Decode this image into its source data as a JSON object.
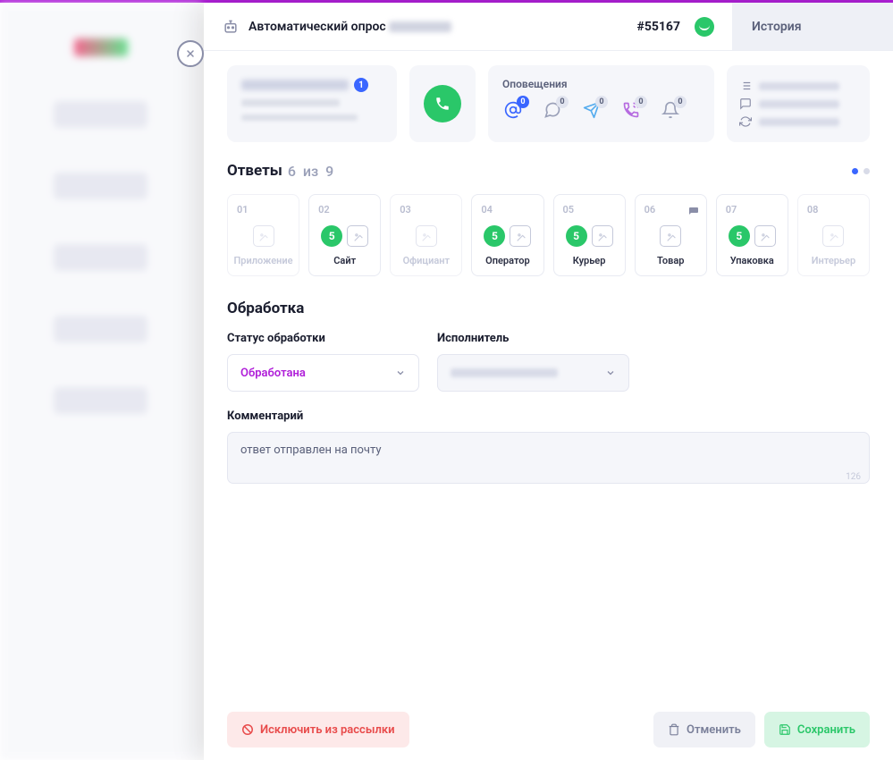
{
  "header": {
    "title_prefix": "Автоматический опрос",
    "ticket_id": "#55167",
    "history_tab": "История"
  },
  "customer": {
    "badge": "1"
  },
  "notifications": {
    "title": "Оповещения",
    "items": [
      {
        "name": "email",
        "count": "0",
        "active": true
      },
      {
        "name": "sms",
        "count": "0",
        "active": false
      },
      {
        "name": "telegram",
        "count": "0",
        "active": false
      },
      {
        "name": "viber",
        "count": "0",
        "active": false
      },
      {
        "name": "bell",
        "count": "0",
        "active": false
      }
    ]
  },
  "answers": {
    "title": "Ответы",
    "count_shown": "6",
    "count_sep": "из",
    "count_total": "9",
    "items": [
      {
        "num": "01",
        "label": "Приложение",
        "score": null,
        "muted": true,
        "chat": false
      },
      {
        "num": "02",
        "label": "Сайт",
        "score": "5",
        "muted": false,
        "chat": false
      },
      {
        "num": "03",
        "label": "Официант",
        "score": null,
        "muted": true,
        "chat": false
      },
      {
        "num": "04",
        "label": "Оператор",
        "score": "5",
        "muted": false,
        "chat": false
      },
      {
        "num": "05",
        "label": "Курьер",
        "score": "5",
        "muted": false,
        "chat": false
      },
      {
        "num": "06",
        "label": "Товар",
        "score": null,
        "muted": false,
        "chat": true
      },
      {
        "num": "07",
        "label": "Упаковка",
        "score": "5",
        "muted": false,
        "chat": false
      },
      {
        "num": "08",
        "label": "Интерьер",
        "score": null,
        "muted": true,
        "chat": false
      }
    ]
  },
  "processing": {
    "title": "Обработка",
    "status_label": "Статус обработки",
    "status_value": "Обработана",
    "assignee_label": "Исполнитель",
    "comment_label": "Комментарий",
    "comment_value": "ответ отправлен на почту",
    "char_count": "126"
  },
  "footer": {
    "exclude": "Исключить из рассылки",
    "cancel": "Отменить",
    "save": "Сохранить"
  }
}
